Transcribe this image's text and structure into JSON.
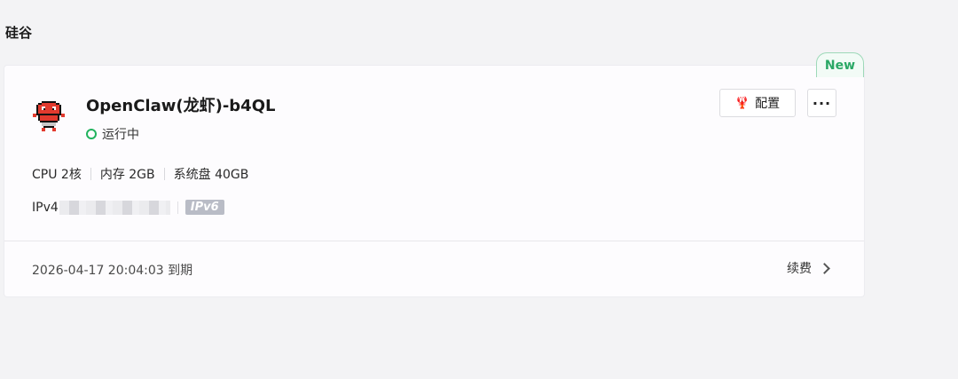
{
  "region": {
    "title": "硅谷"
  },
  "instance": {
    "badge": "New",
    "name": "OpenClaw(龙虾)-b4QL",
    "status": "运行中",
    "status_color": "#22b35e",
    "logo_icon": "lobster-pixel-icon"
  },
  "actions": {
    "config_label": "配置",
    "config_icon": "lobster-icon",
    "more_label": "···"
  },
  "specs": {
    "cpu": "CPU 2核",
    "memory": "内存 2GB",
    "disk": "系统盘 40GB"
  },
  "network": {
    "ipv4_label": "IPv4",
    "ipv6_tag": "IPv6"
  },
  "footer": {
    "expiry": "2026-04-17 20:04:03 到期",
    "renew_label": "续费"
  },
  "colors": {
    "accent_green": "#2aa865",
    "badge_border": "#9ed9b9",
    "ipv6_bg": "#b9bcc6"
  }
}
